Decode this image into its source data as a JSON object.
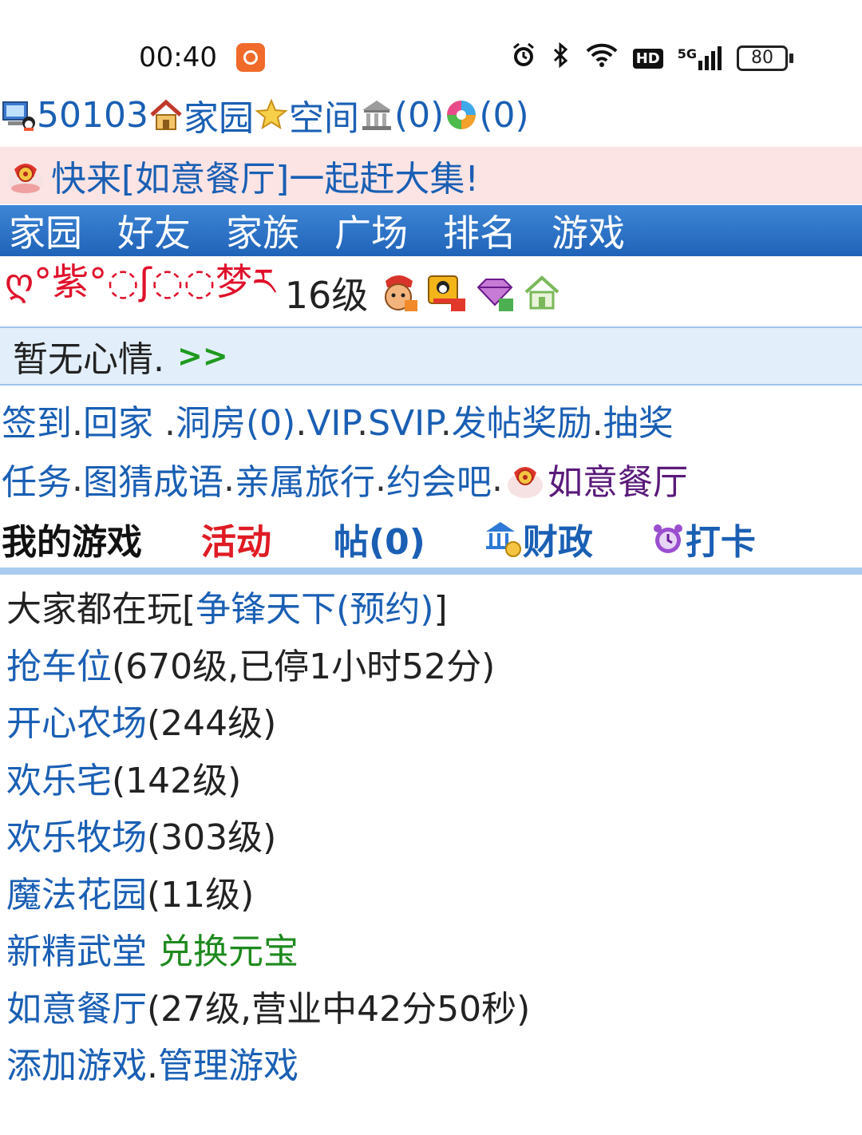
{
  "status_bar": {
    "time": "00:40",
    "network": "5G",
    "hd": "HD",
    "battery": "80"
  },
  "header": {
    "user_id": "50103",
    "home_label": "家园",
    "space_label": "空间",
    "bank_count": "(0)",
    "photo_count": "(0)"
  },
  "banner": {
    "text": "快来[如意餐厅]一起赶大集!"
  },
  "nav": {
    "tabs": [
      "家园",
      "好友",
      "家族",
      "广场",
      "排名",
      "游戏"
    ]
  },
  "profile": {
    "nickname": "ღ°紫°◌ʃ◌◌梦ར",
    "level": "16级"
  },
  "mood": {
    "text": "暂无心情.",
    "more": ">>"
  },
  "links_row1": [
    "签到",
    "回家 ",
    "洞房(0)",
    "VIP",
    "SVIP",
    "发帖奖励",
    "抽奖"
  ],
  "links_row2": [
    "任务",
    "图猜成语",
    "亲属旅行",
    "约会吧",
    "如意餐厅"
  ],
  "quick": {
    "my_games": "我的游戏",
    "activity": "活动",
    "posts": "帖(0)",
    "finance": "财政",
    "checkin": "打卡"
  },
  "games": {
    "popular_prefix": "大家都在玩[",
    "popular_game": "争锋天下(预约)",
    "popular_suffix": "]",
    "items": [
      {
        "name": "抢车位",
        "detail": "(670级,已停1小时52分)"
      },
      {
        "name": "开心农场",
        "detail": "(244级)"
      },
      {
        "name": "欢乐宅",
        "detail": "(142级)"
      },
      {
        "name": "欢乐牧场",
        "detail": "(303级)"
      },
      {
        "name": "魔法花园",
        "detail": "(11级)"
      }
    ],
    "xinjing": "新精武堂",
    "exchange": "兑换元宝",
    "ruyi_name": "如意餐厅",
    "ruyi_detail": "(27级,营业中42分50秒)",
    "add_game": "添加游戏",
    "dot": ".",
    "manage_game": "管理游戏"
  },
  "colors": {
    "link": "#1a5fb4",
    "nav_bg": "#2a70c6",
    "banner_bg": "#fde4e4",
    "mood_bg": "#e2eef9",
    "activity": "#e01b24",
    "exchange": "#1e8a1e"
  }
}
